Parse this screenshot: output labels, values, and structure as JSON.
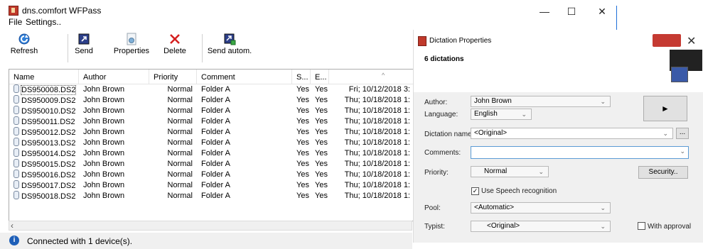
{
  "window": {
    "title": "dns.comfort WFPass",
    "minimize": "—",
    "maximize": "☐",
    "close": "✕"
  },
  "menu": [
    "File",
    "Settings.."
  ],
  "toolbar": {
    "refresh": "Refresh",
    "send": "Send",
    "properties": "Properties",
    "delete": "Delete",
    "send_autom": "Send autom."
  },
  "columns": {
    "name": "Name",
    "author": "Author",
    "priority": "Priority",
    "comment": "Comment",
    "s": "S...",
    "e": "E..."
  },
  "rows": [
    {
      "name": "DS950008.DS2",
      "author": "John Brown",
      "priority": "Normal",
      "comment": "Folder A",
      "s": "Yes",
      "e": "Yes",
      "date": "Fri; 10/12/2018 3:"
    },
    {
      "name": "DS950009.DS2",
      "author": "John Brown",
      "priority": "Normal",
      "comment": "Folder A",
      "s": "Yes",
      "e": "Yes",
      "date": "Thu; 10/18/2018 1:"
    },
    {
      "name": "DS950010.DS2",
      "author": "John Brown",
      "priority": "Normal",
      "comment": "Folder A",
      "s": "Yes",
      "e": "Yes",
      "date": "Thu; 10/18/2018 1:"
    },
    {
      "name": "DS950011.DS2",
      "author": "John Brown",
      "priority": "Normal",
      "comment": "Folder A",
      "s": "Yes",
      "e": "Yes",
      "date": "Thu; 10/18/2018 1:"
    },
    {
      "name": "DS950012.DS2",
      "author": "John Brown",
      "priority": "Normal",
      "comment": "Folder A",
      "s": "Yes",
      "e": "Yes",
      "date": "Thu; 10/18/2018 1:"
    },
    {
      "name": "DS950013.DS2",
      "author": "John Brown",
      "priority": "Normal",
      "comment": "Folder A",
      "s": "Yes",
      "e": "Yes",
      "date": "Thu; 10/18/2018 1:"
    },
    {
      "name": "DS950014.DS2",
      "author": "John Brown",
      "priority": "Normal",
      "comment": "Folder A",
      "s": "Yes",
      "e": "Yes",
      "date": "Thu; 10/18/2018 1:"
    },
    {
      "name": "DS950015.DS2",
      "author": "John Brown",
      "priority": "Normal",
      "comment": "Folder A",
      "s": "Yes",
      "e": "Yes",
      "date": "Thu; 10/18/2018 1:"
    },
    {
      "name": "DS950016.DS2",
      "author": "John Brown",
      "priority": "Normal",
      "comment": "Folder A",
      "s": "Yes",
      "e": "Yes",
      "date": "Thu; 10/18/2018 1:"
    },
    {
      "name": "DS950017.DS2",
      "author": "John Brown",
      "priority": "Normal",
      "comment": "Folder A",
      "s": "Yes",
      "e": "Yes",
      "date": "Thu; 10/18/2018 1:"
    },
    {
      "name": "DS950018.DS2",
      "author": "John Brown",
      "priority": "Normal",
      "comment": "Folder A",
      "s": "Yes",
      "e": "Yes",
      "date": "Thu; 10/18/2018 1:"
    }
  ],
  "status": {
    "text": "Connected with 1 device(s)."
  },
  "dialog": {
    "title": "Dictation Properties",
    "subtitle": "6 dictations",
    "close": "✕",
    "author_label": "Author:",
    "author_value": "John Brown",
    "language_label": "Language:",
    "language_value": "English",
    "play_symbol": "►",
    "dictation_name_label": "Dictation name:",
    "dictation_name_value": "<Original>",
    "browse_label": "...",
    "comments_label": "Comments:",
    "comments_value": "",
    "priority_label": "Priority:",
    "priority_value": "Normal",
    "security_label": "Security..",
    "speech_label": "Use Speech recognition",
    "speech_checked": true,
    "pool_label": "Pool:",
    "pool_value": "<Automatic>",
    "typist_label": "Typist:",
    "typist_value": "<Original>",
    "approval_label": "With approval",
    "approval_checked": false
  }
}
